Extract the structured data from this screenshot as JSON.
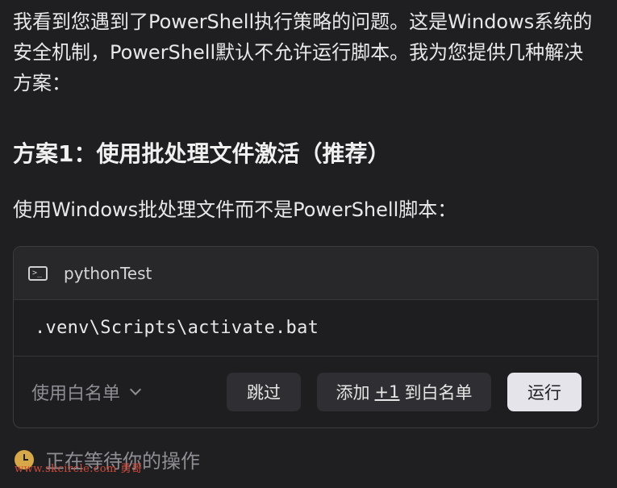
{
  "message": {
    "intro": "我看到您遇到了PowerShell执行策略的问题。这是Windows系统的安全机制，PowerShell默认不允许运行脚本。我为您提供几种解决方案：",
    "heading": "方案1：使用批处理文件激活（推荐）",
    "subtext": "使用Windows批处理文件而不是PowerShell脚本："
  },
  "command_card": {
    "icon": "terminal-icon",
    "title": "pythonTest",
    "code": ".venv\\Scripts\\activate.bat",
    "whitelist_label": "使用白名单",
    "skip_label": "跳过",
    "add_prefix": "添加",
    "add_count": "+1",
    "add_suffix": "到白名单",
    "run_label": "运行"
  },
  "status": {
    "icon": "clock-icon",
    "text": "正在等待你的操作"
  },
  "watermark": "www.skcircle.com 勇哥",
  "colors": {
    "background": "#1f1f21",
    "card_header": "#28282b",
    "run_button": "#e4e4ea",
    "clock": "#d6a84a",
    "watermark": "#d04a3a"
  }
}
